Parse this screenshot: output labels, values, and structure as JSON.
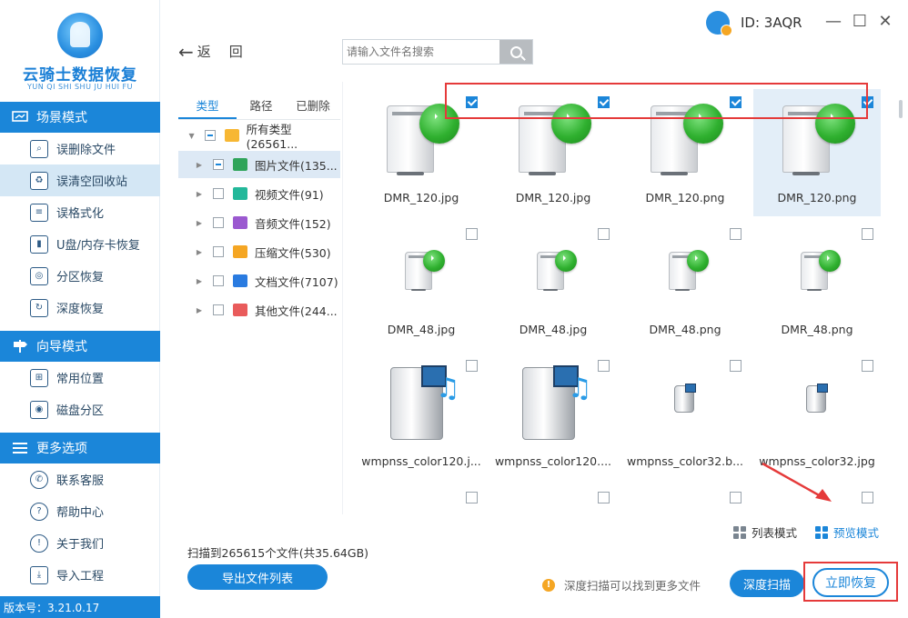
{
  "app": {
    "logo_title": "云骑士数据恢复",
    "logo_subtitle": "YUN QI SHI SHU JU HUI FU",
    "version": "版本号：3.21.0.17",
    "user_id": "ID: 3AQR",
    "win_controls": {
      "minimize": "—",
      "maximize": "☐",
      "close": "✕"
    }
  },
  "sidebar": {
    "sections": [
      {
        "title": "场景模式",
        "items": [
          "误删除文件",
          "误清空回收站",
          "误格式化",
          "U盘/内存卡恢复",
          "分区恢复",
          "深度恢复"
        ]
      },
      {
        "title": "向导模式",
        "items": [
          "常用位置",
          "磁盘分区"
        ]
      },
      {
        "title": "更多选项",
        "items": [
          "联系客服",
          "帮助中心",
          "关于我们",
          "导入工程"
        ]
      }
    ],
    "active_item": "误清空回收站"
  },
  "toolbar": {
    "back_arrow": "←",
    "back_label": "返",
    "back_label2": "回",
    "search_placeholder": "请输入文件名搜索"
  },
  "tree": {
    "tabs": [
      "类型",
      "路径",
      "已删除"
    ],
    "active_tab": "类型",
    "rows": [
      {
        "label": "所有类型(26561...",
        "caret": "▼",
        "icon": "folder-icon",
        "color": "#f7b733"
      },
      {
        "label": "图片文件(135...",
        "caret": "▶",
        "icon": "image-icon",
        "color": "#2fa45a"
      },
      {
        "label": "视频文件(91)",
        "caret": "▶",
        "icon": "video-icon",
        "color": "#23b89a"
      },
      {
        "label": "音频文件(152)",
        "caret": "▶",
        "icon": "audio-icon",
        "color": "#9b59d0"
      },
      {
        "label": "压缩文件(530)",
        "caret": "▶",
        "icon": "zip-icon",
        "color": "#f5a623"
      },
      {
        "label": "文档文件(7107)",
        "caret": "▶",
        "icon": "doc-icon",
        "color": "#2a7be0"
      },
      {
        "label": "其他文件(244...",
        "caret": "▶",
        "icon": "other-icon",
        "color": "#e95b5b"
      }
    ]
  },
  "files": [
    {
      "name": "DMR_120.jpg",
      "checked": true,
      "icon": "media-server-icon"
    },
    {
      "name": "DMR_120.jpg",
      "checked": true,
      "icon": "media-server-icon"
    },
    {
      "name": "DMR_120.png",
      "checked": true,
      "icon": "media-server-icon"
    },
    {
      "name": "DMR_120.png",
      "checked": true,
      "icon": "media-server-icon"
    },
    {
      "name": "DMR_48.jpg",
      "checked": false,
      "icon": "media-server-icon"
    },
    {
      "name": "DMR_48.jpg",
      "checked": false,
      "icon": "media-server-icon"
    },
    {
      "name": "DMR_48.png",
      "checked": false,
      "icon": "media-server-icon"
    },
    {
      "name": "DMR_48.png",
      "checked": false,
      "icon": "media-server-icon"
    },
    {
      "name": "wmpnss_color120.j...",
      "checked": false,
      "icon": "media-device-icon"
    },
    {
      "name": "wmpnss_color120....",
      "checked": false,
      "icon": "media-device-icon"
    },
    {
      "name": "wmpnss_color32.b...",
      "checked": false,
      "icon": "media-device-icon"
    },
    {
      "name": "wmpnss_color32.jpg",
      "checked": false,
      "icon": "media-device-icon"
    }
  ],
  "view_modes": {
    "list": "列表模式",
    "preview": "预览模式",
    "active": "预览模式"
  },
  "footer": {
    "scan_info": "扫描到265615个文件(共35.64GB)",
    "export_label": "导出文件列表",
    "tip_text": "深度扫描可以找到更多文件",
    "deep_scan_label": "深度扫描",
    "recover_label": "立即恢复"
  },
  "colors": {
    "accent": "#1b86d9",
    "annotation": "#e53a3a"
  }
}
